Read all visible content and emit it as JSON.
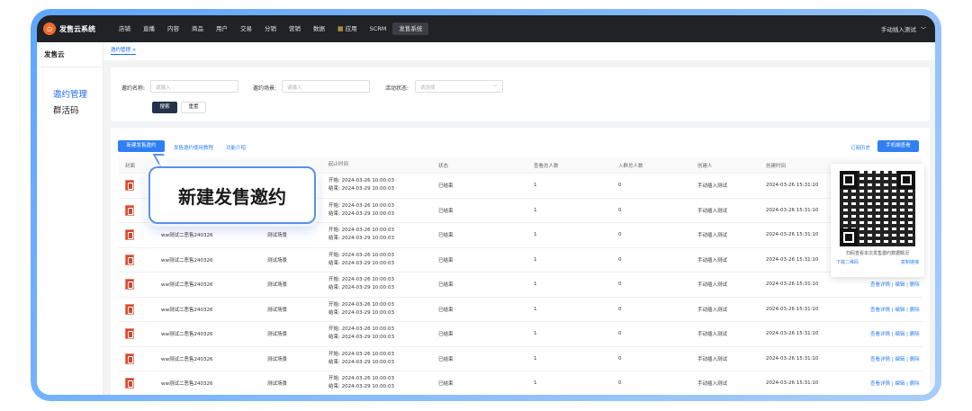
{
  "app": {
    "name": "发售云系统",
    "logo_glyph": "⊙"
  },
  "nav": {
    "items": [
      "店铺",
      "直播",
      "内容",
      "商品",
      "用户",
      "交易",
      "分销",
      "营销",
      "数据"
    ],
    "apps_label": "应用",
    "apps_icon": "grid-icon",
    "scrm": "SCRM",
    "active": "发售系统",
    "user": "手动插入测试",
    "user_chevron": "﹀"
  },
  "sidebar": {
    "title": "发售云",
    "items": [
      "邀约管理",
      "群活码"
    ]
  },
  "breadcrumb": "邀约管理  ×",
  "filter": {
    "name_label": "邀约名称:",
    "name_placeholder": "请输入",
    "scene_label": "邀约场景:",
    "scene_placeholder": "请输入",
    "status_label": "活动状态:",
    "status_placeholder": "请选择",
    "search_btn": "搜索",
    "reset_btn": "重置"
  },
  "toolbar": {
    "new_btn": "新建发售邀约",
    "tutorial_link": "发售邀约使用教程",
    "intro_link": "功能介绍",
    "history_link": "订阅历史",
    "mobile_btn": "手机端查看"
  },
  "table": {
    "headers": {
      "cover": "封面",
      "time": "起止时间",
      "status": "状态",
      "view": "查看总人数",
      "join": "入群总人数",
      "creator": "创建人",
      "created": "创建时间"
    },
    "rows": [
      {
        "name": "",
        "scene": "",
        "start": "开始: 2024-03-26 10:00:03",
        "end": "结束: 2024-03-29 10:00:03",
        "status": "已结束",
        "view": "1",
        "join": "0",
        "creator": "手动插入测试",
        "created": "2024-03-26 15:31:10",
        "ops": ""
      },
      {
        "name": "",
        "scene": "",
        "start": "开始: 2024-03-26 10:00:03",
        "end": "结束: 2024-03-29 10:00:03",
        "status": "已结束",
        "view": "1",
        "join": "0",
        "creator": "手动插入测试",
        "created": "2024-03-26 15:31:10",
        "ops": ""
      },
      {
        "name": "ww测试二恶售240326",
        "scene": "测试场景",
        "start": "开始: 2024-03-26 10:00:03",
        "end": "结束: 2024-03-29 10:00:03",
        "status": "已结束",
        "view": "1",
        "join": "0",
        "creator": "手动插入测试",
        "created": "2024-03-26 15:31:10",
        "ops": ""
      },
      {
        "name": "ww测试二恶售240326",
        "scene": "测试场景",
        "start": "开始: 2024-03-26 10:00:03",
        "end": "结束: 2024-03-29 10:00:03",
        "status": "已结束",
        "view": "1",
        "join": "0",
        "creator": "手动插入测试",
        "created": "2024-03-26 15:31:10",
        "ops": ""
      },
      {
        "name": "ww测试二恶售240326",
        "scene": "测试场景",
        "start": "开始: 2024-03-26 10:00:03",
        "end": "结束: 2024-03-29 10:00:03",
        "status": "已结束",
        "view": "1",
        "join": "0",
        "creator": "手动插入测试",
        "created": "2024-03-26 15:31:10",
        "ops": "查看详情 | 编辑 | 删除"
      },
      {
        "name": "ww测试二恶售240326",
        "scene": "测试场景",
        "start": "开始: 2024-03-26 10:00:03",
        "end": "结束: 2024-03-29 10:00:03",
        "status": "已结束",
        "view": "1",
        "join": "0",
        "creator": "手动插入测试",
        "created": "2024-03-26 15:31:10",
        "ops": "查看详情 | 编辑 | 删除"
      },
      {
        "name": "ww测试二恶售240326",
        "scene": "测试场景",
        "start": "开始: 2024-03-26 10:00:03",
        "end": "结束: 2024-03-29 10:00:03",
        "status": "已结束",
        "view": "1",
        "join": "0",
        "creator": "手动插入测试",
        "created": "2024-03-26 15:31:10",
        "ops": "查看详情 | 编辑 | 删除"
      },
      {
        "name": "ww测试二恶售240326",
        "scene": "测试场景",
        "start": "开始: 2024-03-26 10:00:03",
        "end": "结束: 2024-03-29 10:00:03",
        "status": "已结束",
        "view": "1",
        "join": "0",
        "creator": "手动插入测试",
        "created": "2024-03-26 15:31:10",
        "ops": "查看详情 | 编辑 | 删除"
      },
      {
        "name": "ww测试二恶售240326",
        "scene": "测试场景",
        "start": "开始: 2024-03-26 10:00:03",
        "end": "结束: 2024-03-29 10:00:03",
        "status": "已结束",
        "view": "1",
        "join": "0",
        "creator": "手动插入测试",
        "created": "2024-03-26 15:31:10",
        "ops": "查看详情 | 编辑 | 删除"
      }
    ]
  },
  "callout": "新建发售邀约",
  "qr": {
    "caption": "扫码查看本次发售邀约数据概况",
    "download": "下载二维码",
    "copy": "复制链接"
  },
  "colors": {
    "accent": "#2f7ff5",
    "topbar": "#202226",
    "brand": "#f2682b"
  }
}
